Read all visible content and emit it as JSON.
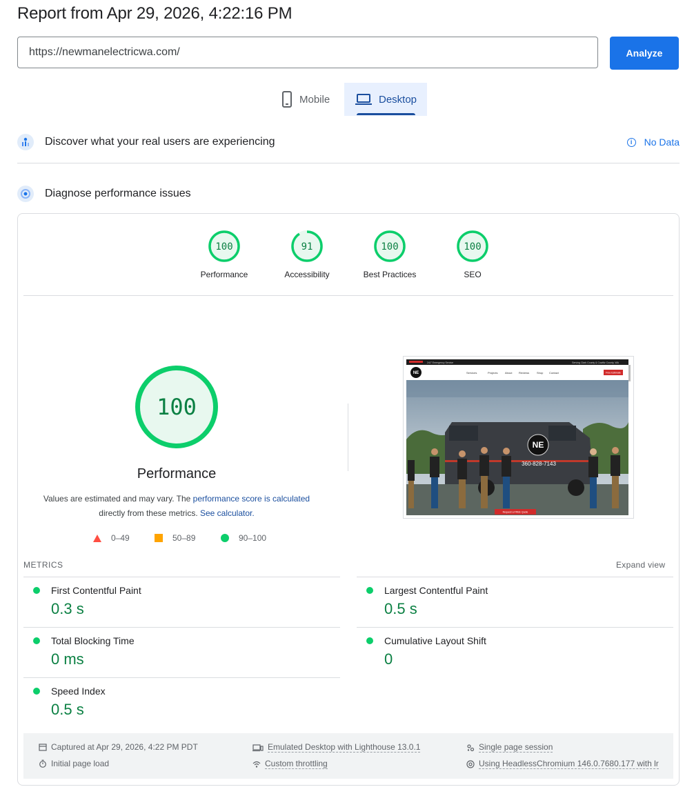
{
  "header": {
    "report_title": "Report from Apr 29, 2026, 4:22:16 PM",
    "url_value": "https://newmanelectricwa.com/",
    "analyze_label": "Analyze"
  },
  "tabs": [
    {
      "label": "Mobile",
      "active": false
    },
    {
      "label": "Desktop",
      "active": true
    }
  ],
  "field_data": {
    "title": "Discover what your real users are experiencing",
    "status": "No Data"
  },
  "lab_data": {
    "title": "Diagnose performance issues"
  },
  "categories": [
    {
      "label": "Performance",
      "score": "100",
      "fraction": 1.0
    },
    {
      "label": "Accessibility",
      "score": "91",
      "fraction": 0.91
    },
    {
      "label": "Best Practices",
      "score": "100",
      "fraction": 1.0
    },
    {
      "label": "SEO",
      "score": "100",
      "fraction": 1.0
    }
  ],
  "performance": {
    "score": "100",
    "title": "Performance",
    "desc_prefix": "Values are estimated and may vary. The ",
    "desc_link1": "performance score is calculated",
    "desc_middle": "directly from these metrics. ",
    "desc_link2": "See calculator.",
    "legend": [
      {
        "range": "0–49",
        "color": "#ff4e42"
      },
      {
        "range": "50–89",
        "color": "#ffa400"
      },
      {
        "range": "90–100",
        "color": "#0cce6b"
      }
    ]
  },
  "screenshot": {
    "top_bar_left": "24/7 Emergency Service",
    "top_bar_right": "Serving Clark County & Cowlitz County, WA",
    "nav": [
      "Services",
      "Projects",
      "About",
      "Reviews",
      "Shop",
      "Contact"
    ],
    "cta": "Free Estimate",
    "logo_text": "NE",
    "van_phone": "360-828-7143",
    "hero_button": "Request a FREE Quote"
  },
  "metrics": {
    "heading": "METRICS",
    "expand_label": "Expand view",
    "items": [
      {
        "label": "First Contentful Paint",
        "value": "0.3 s"
      },
      {
        "label": "Largest Contentful Paint",
        "value": "0.5 s"
      },
      {
        "label": "Total Blocking Time",
        "value": "0 ms"
      },
      {
        "label": "Cumulative Layout Shift",
        "value": "0"
      },
      {
        "label": "Speed Index",
        "value": "0.5 s"
      }
    ]
  },
  "footer": {
    "captured": "Captured at Apr 29, 2026, 4:22 PM PDT",
    "initial_load": "Initial page load",
    "emulated": "Emulated Desktop with Lighthouse 13.0.1",
    "throttling": "Custom throttling",
    "session": "Single page session",
    "browser": "Using HeadlessChromium 146.0.7680.177 with lr"
  },
  "colors": {
    "accent": "#1a73e8",
    "pass": "#0cce6b",
    "pass_text": "#0b8043"
  }
}
